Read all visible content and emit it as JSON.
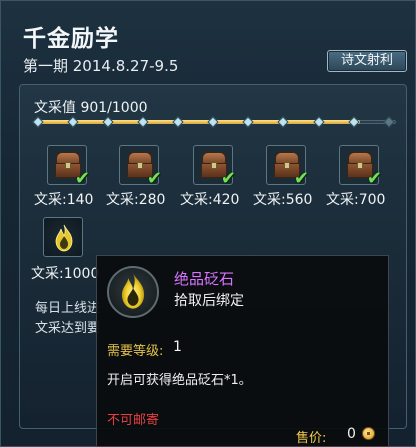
{
  "window": {
    "title": "千金励学",
    "period": "第一期 2014.8.27-9.5",
    "ticket_button": "诗文射利"
  },
  "progress": {
    "label": "文采值 901/1000",
    "current": 901,
    "max": 1000,
    "fraction": 0.901,
    "node_count": 11
  },
  "rewards": [
    {
      "label": "文采:140",
      "claimed": true,
      "icon": "treasure-chest-icon"
    },
    {
      "label": "文采:280",
      "claimed": true,
      "icon": "treasure-chest-icon"
    },
    {
      "label": "文采:420",
      "claimed": true,
      "icon": "treasure-chest-icon"
    },
    {
      "label": "文采:560",
      "claimed": true,
      "icon": "treasure-chest-icon"
    },
    {
      "label": "文采:700",
      "claimed": true,
      "icon": "treasure-chest-icon"
    },
    {
      "label": "文采:1000",
      "claimed": false,
      "icon": "flame-stone-icon"
    }
  ],
  "description": {
    "line1": "每日上线进",
    "line2": "文采达到要"
  },
  "tooltip": {
    "item_name": "绝品砭石",
    "bind_text": "拾取后绑定",
    "level_label": "需要等级:",
    "level_value": "1",
    "use_text": "开启可获得绝品砭石*1。",
    "mail_text": "不可邮寄",
    "price_label": "售价:",
    "price_value": "0",
    "icon": "flame-stone-icon"
  },
  "colors": {
    "item_name": "#d974ff",
    "level_label": "#e3c24a",
    "no_mail": "#e64040",
    "price_label": "#f2c94a",
    "check": "#74e05a",
    "bar_fill": "#e9bf52"
  }
}
